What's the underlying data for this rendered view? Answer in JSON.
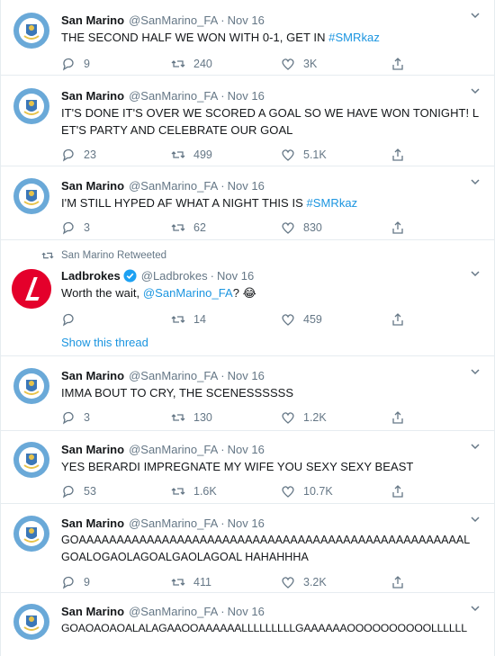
{
  "colors": {
    "accent": "#1b95e0",
    "muted": "#657786",
    "text": "#14171a",
    "ladbrokes_red": "#e4002b"
  },
  "retweet_label": "San Marino Retweeted",
  "show_thread": "Show this thread",
  "tweets": [
    {
      "name": "San Marino",
      "handle": "@SanMarino_FA",
      "date": "Nov 16",
      "text": "THE SECOND HALF WE WON WITH 0-1, GET IN ",
      "hashtag": "#SMRkaz",
      "replies": "9",
      "retweets": "240",
      "likes": "3K"
    },
    {
      "name": "San Marino",
      "handle": "@SanMarino_FA",
      "date": "Nov 16",
      "text": "IT'S DONE IT'S OVER WE SCORED A GOAL SO WE HAVE WON TONIGHT! LET'S PARTY AND CELEBRATE OUR GOAL",
      "replies": "23",
      "retweets": "499",
      "likes": "5.1K"
    },
    {
      "name": "San Marino",
      "handle": "@SanMarino_FA",
      "date": "Nov 16",
      "text": "I'M STILL HYPED AF WHAT A NIGHT THIS IS ",
      "hashtag": "#SMRkaz",
      "replies": "3",
      "retweets": "62",
      "likes": "830"
    },
    {
      "name": "Ladbrokes",
      "handle": "@Ladbrokes",
      "date": "Nov 16",
      "text": "Worth the wait, ",
      "mention": "@SanMarino_FA",
      "text_after": "? 😂",
      "replies": "",
      "retweets": "14",
      "likes": "459"
    },
    {
      "name": "San Marino",
      "handle": "@SanMarino_FA",
      "date": "Nov 16",
      "text": "IMMA BOUT TO CRY, THE SCENESSSSSS",
      "replies": "3",
      "retweets": "130",
      "likes": "1.2K"
    },
    {
      "name": "San Marino",
      "handle": "@SanMarino_FA",
      "date": "Nov 16",
      "text": "YES BERARDI IMPREGNATE MY WIFE YOU SEXY SEXY BEAST",
      "replies": "53",
      "retweets": "1.6K",
      "likes": "10.7K"
    },
    {
      "name": "San Marino",
      "handle": "@SanMarino_FA",
      "date": "Nov 16",
      "text": "GOAAAAAAAAAAAAAAAAAAAAAAAAAAAAAAAAAAAAAAAAAAAAAAAAAAAL GOALOGAOLAGOALGAOLAGOAL HAHAHHHA",
      "replies": "9",
      "retweets": "411",
      "likes": "3.2K"
    },
    {
      "name": "San Marino",
      "handle": "@SanMarino_FA",
      "date": "Nov 16",
      "text": "GOAOAOAOALALAGAAOOAAAAAALLLLLLLLLGAAAAAAOOOOOOOOOOLLLLLL"
    }
  ]
}
